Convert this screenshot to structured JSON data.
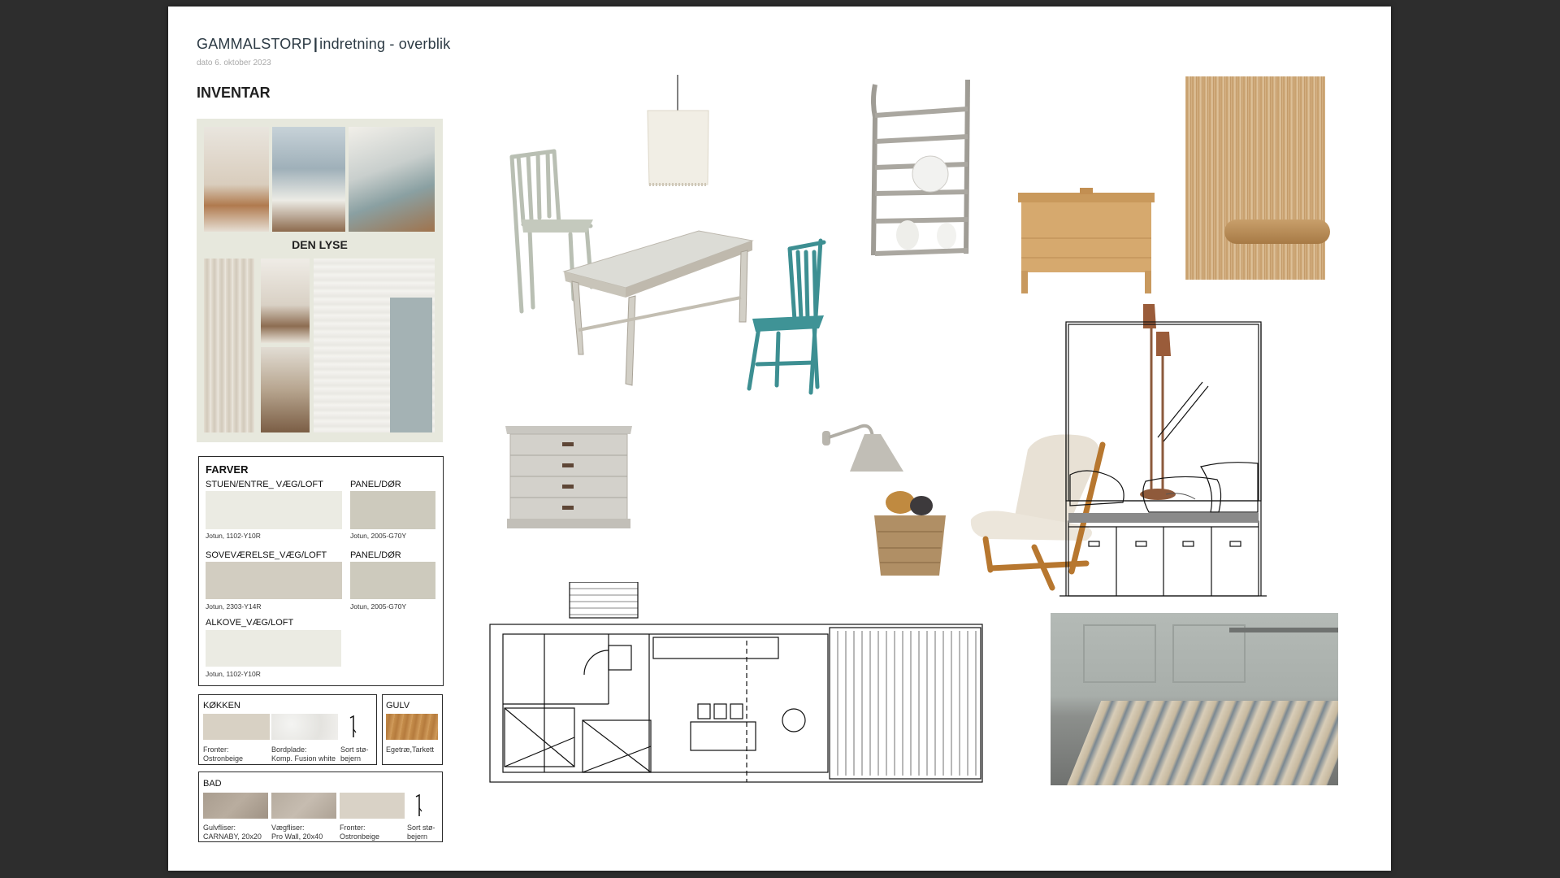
{
  "header": {
    "brand": "GAMMALSTORP",
    "separator": "|",
    "subtitle": "indretning - overblik",
    "date": "dato 6. oktober 2023"
  },
  "section_title": "INVENTAR",
  "moodboard": {
    "label": "DEN LYSE"
  },
  "farver": {
    "title": "FARVER",
    "rows": [
      {
        "label": "STUEN/ENTRE_ VÆG/LOFT",
        "code": "Jotun, 1102-Y10R",
        "color": "#ebebe3",
        "label2": "PANEL/DØR",
        "code2": "Jotun, 2005-G70Y",
        "color2": "#cdcabd"
      },
      {
        "label": "SOVEVÆRELSE_VÆG/LOFT",
        "code": "Jotun, 2303-Y14R",
        "color": "#d2cdc1",
        "label2": "PANEL/DØR",
        "code2": "Jotun, 2005-G70Y",
        "color2": "#cdcabd"
      },
      {
        "label": "ALKOVE_VÆG/LOFT",
        "code": "Jotun, 1102-Y10R",
        "color": "#ebebe3"
      }
    ]
  },
  "kokken": {
    "title": "KØKKEN",
    "items": [
      {
        "caption1": "Fronter:",
        "caption2": "Ostronbeige",
        "color": "#d8d1c4"
      },
      {
        "caption1": "Bordplade:",
        "caption2": "Komp. Fusion white",
        "color": "#ecebe8"
      },
      {
        "caption1": "Sort stø-",
        "caption2": "bejern"
      }
    ]
  },
  "gulv": {
    "title": "GULV",
    "items": [
      {
        "caption1": "Egetræ,Tarkett",
        "color": "#c08b49"
      }
    ]
  },
  "bad": {
    "title": "BAD",
    "items": [
      {
        "caption1": "Gulvfliser:",
        "caption2": "CARNABY, 20x20",
        "color": "#b1a596"
      },
      {
        "caption1": "Vægfliser:",
        "caption2": "Pro Wall, 20x40",
        "color": "#bdb3a8"
      },
      {
        "caption1": "Fronter:",
        "caption2": "Ostronbeige",
        "color": "#d9d2c6"
      },
      {
        "caption1": "Sort stø-",
        "caption2": "bejern"
      }
    ]
  }
}
